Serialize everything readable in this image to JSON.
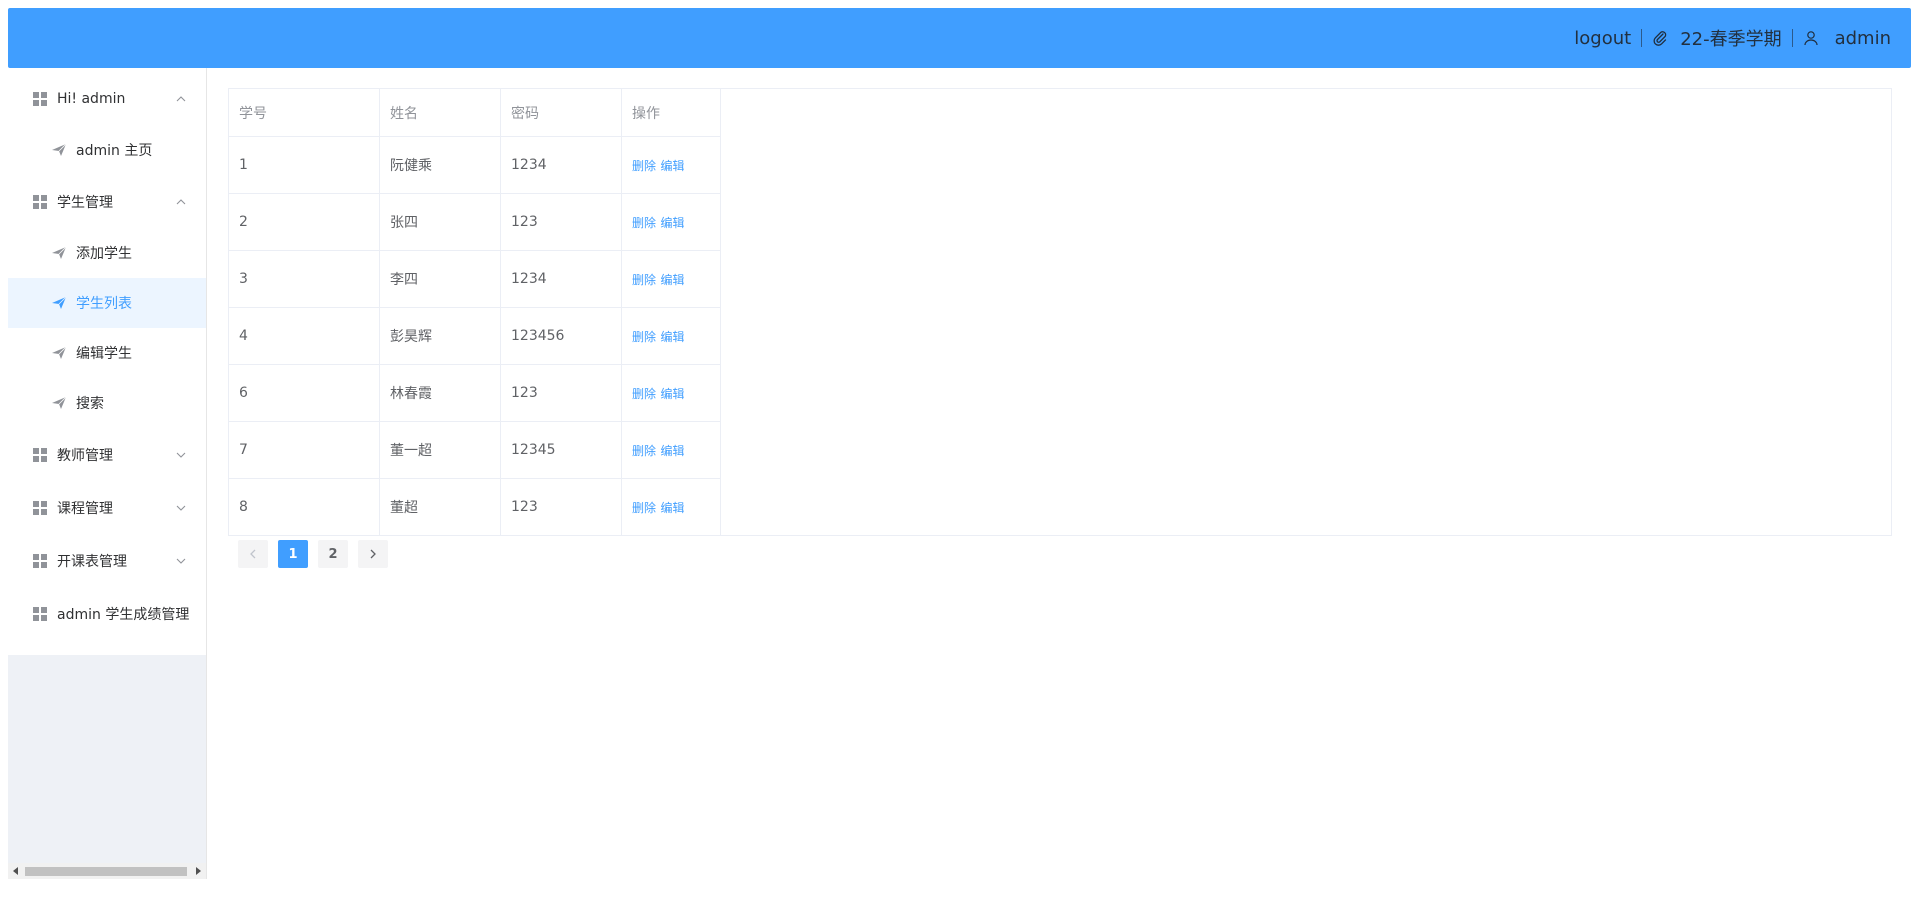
{
  "header": {
    "logout": "logout",
    "term": "22-春季学期",
    "user": "admin",
    "bg_color": "#409eff"
  },
  "sidebar": {
    "groups": [
      {
        "title": "Hi! admin",
        "expanded": true,
        "items": [
          "admin 主页"
        ]
      },
      {
        "title": "学生管理",
        "expanded": true,
        "items": [
          "添加学生",
          "学生列表",
          "编辑学生",
          "搜索"
        ]
      },
      {
        "title": "教师管理",
        "expanded": false
      },
      {
        "title": "课程管理",
        "expanded": false
      },
      {
        "title": "开课表管理",
        "expanded": false
      },
      {
        "title": "admin 学生成绩管理"
      }
    ],
    "active_item": "学生列表",
    "accent_color": "#409eff"
  },
  "table": {
    "headers": [
      "学号",
      "姓名",
      "密码",
      "操作"
    ],
    "rows": [
      {
        "id": "1",
        "name": "阮健乘",
        "password": "1234",
        "delete": "删除",
        "edit": "编辑"
      },
      {
        "id": "2",
        "name": "张四",
        "password": "123",
        "delete": "删除",
        "edit": "编辑"
      },
      {
        "id": "3",
        "name": "李四",
        "password": "1234",
        "delete": "删除",
        "edit": "编辑"
      },
      {
        "id": "4",
        "name": "彭昊辉",
        "password": "123456",
        "delete": "删除",
        "edit": "编辑"
      },
      {
        "id": "6",
        "name": "林春霞",
        "password": "123",
        "delete": "删除",
        "edit": "编辑"
      },
      {
        "id": "7",
        "name": "董一超",
        "password": "12345",
        "delete": "删除",
        "edit": "编辑"
      },
      {
        "id": "8",
        "name": "董超",
        "password": "123",
        "delete": "删除",
        "edit": "编辑"
      }
    ]
  },
  "pagination": {
    "pages": [
      "1",
      "2"
    ],
    "current": "1"
  }
}
